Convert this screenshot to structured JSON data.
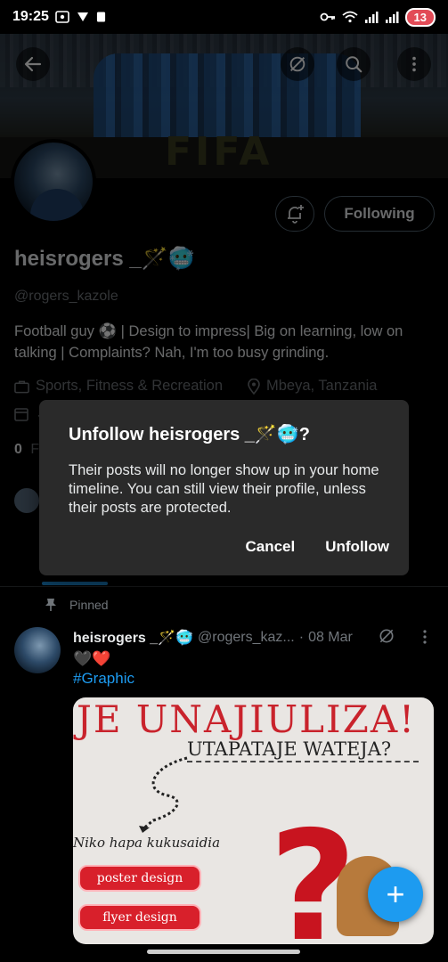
{
  "status_bar": {
    "time": "19:25",
    "battery": "13"
  },
  "profile": {
    "display_name": "heisrogers _🪄🥶",
    "handle": "@rogers_kazole",
    "bio": "Football guy ⚽ | Design to impress| Big on learning, low on talking | Complaints? Nah, I'm too busy grinding.",
    "category": "Sports, Fitness & Recreation",
    "location": "Mbeya, Tanzania",
    "meta_partial": "J",
    "count_partial": "0",
    "count_label_partial": "F",
    "following_button": "Following"
  },
  "pinned_label": "Pinned",
  "tweet": {
    "name": "heisrogers _🪄🥶",
    "handle": "@rogers_kaz...",
    "separator": "·",
    "date": "08 Mar",
    "emoji_line": "🖤❤️",
    "hashtag": "#Graphic",
    "media": {
      "title": "JE UNAJIULIZA!",
      "subtitle": "UTAPATAJE WATEJA?",
      "niko_text": "Niko hapa kukusaidia",
      "buttons": [
        "poster design",
        "flyer design"
      ],
      "question_mark": "?"
    }
  },
  "dialog": {
    "title": "Unfollow heisrogers _🪄🥶?",
    "message": "Their posts will no longer show up in your home timeline. You can still view their profile, unless their posts are protected.",
    "cancel": "Cancel",
    "confirm": "Unfollow"
  },
  "banner_text": "FIFA",
  "fab_symbol": "+",
  "colors": {
    "accent": "#1d9bf0",
    "background": "#000000",
    "dialog_bg": "#2a2a2a",
    "muted_text": "#71767b"
  },
  "icons": {
    "back": "arrow-left-icon",
    "grok": "grok-icon",
    "search": "search-icon",
    "more": "more-vertical-icon",
    "bell": "bell-plus-icon",
    "category": "briefcase-icon",
    "location": "location-pin-icon",
    "calendar": "calendar-icon",
    "pin": "pin-icon"
  }
}
